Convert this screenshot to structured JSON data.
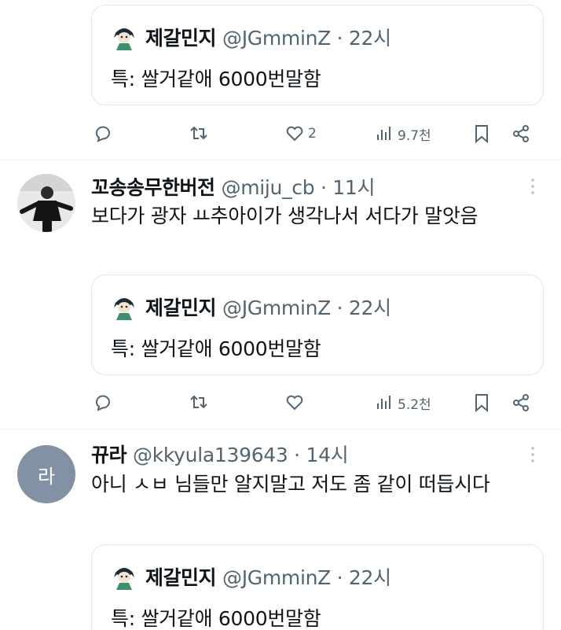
{
  "quoted_tweet": {
    "name": "제갈민지",
    "meta": "@JGmminZ · 22시",
    "text": "특: 쌀거같애 6000번말함"
  },
  "posts": [
    {
      "actions": {
        "reply": "",
        "retweet": "",
        "like": "2",
        "views": "9.7천"
      }
    },
    {
      "name": "꼬송송무한버전",
      "meta": "@miju_cb · 11시",
      "text": "보다가 광자 ㅛ추아이가 생각나서 서다가 말앗음",
      "actions": {
        "reply": "",
        "retweet": "",
        "like": "",
        "views": "5.2천"
      }
    },
    {
      "name": "뀨라",
      "meta": "@kkyula139643 · 14시",
      "avatar_letter": "라",
      "text": "아니 ㅅㅂ 님들만 알지말고 저도 좀 같이 떠듭시다"
    }
  ],
  "icons": {
    "reply": "reply-icon",
    "retweet": "retweet-icon",
    "like": "heart-icon",
    "views": "views-icon",
    "bookmark": "bookmark-icon",
    "share": "share-icon",
    "more": "more-icon"
  },
  "colors": {
    "text": "#0f1419",
    "secondary": "#536471",
    "border": "#e3e6ea",
    "avatar_bg": "#8292a4"
  }
}
